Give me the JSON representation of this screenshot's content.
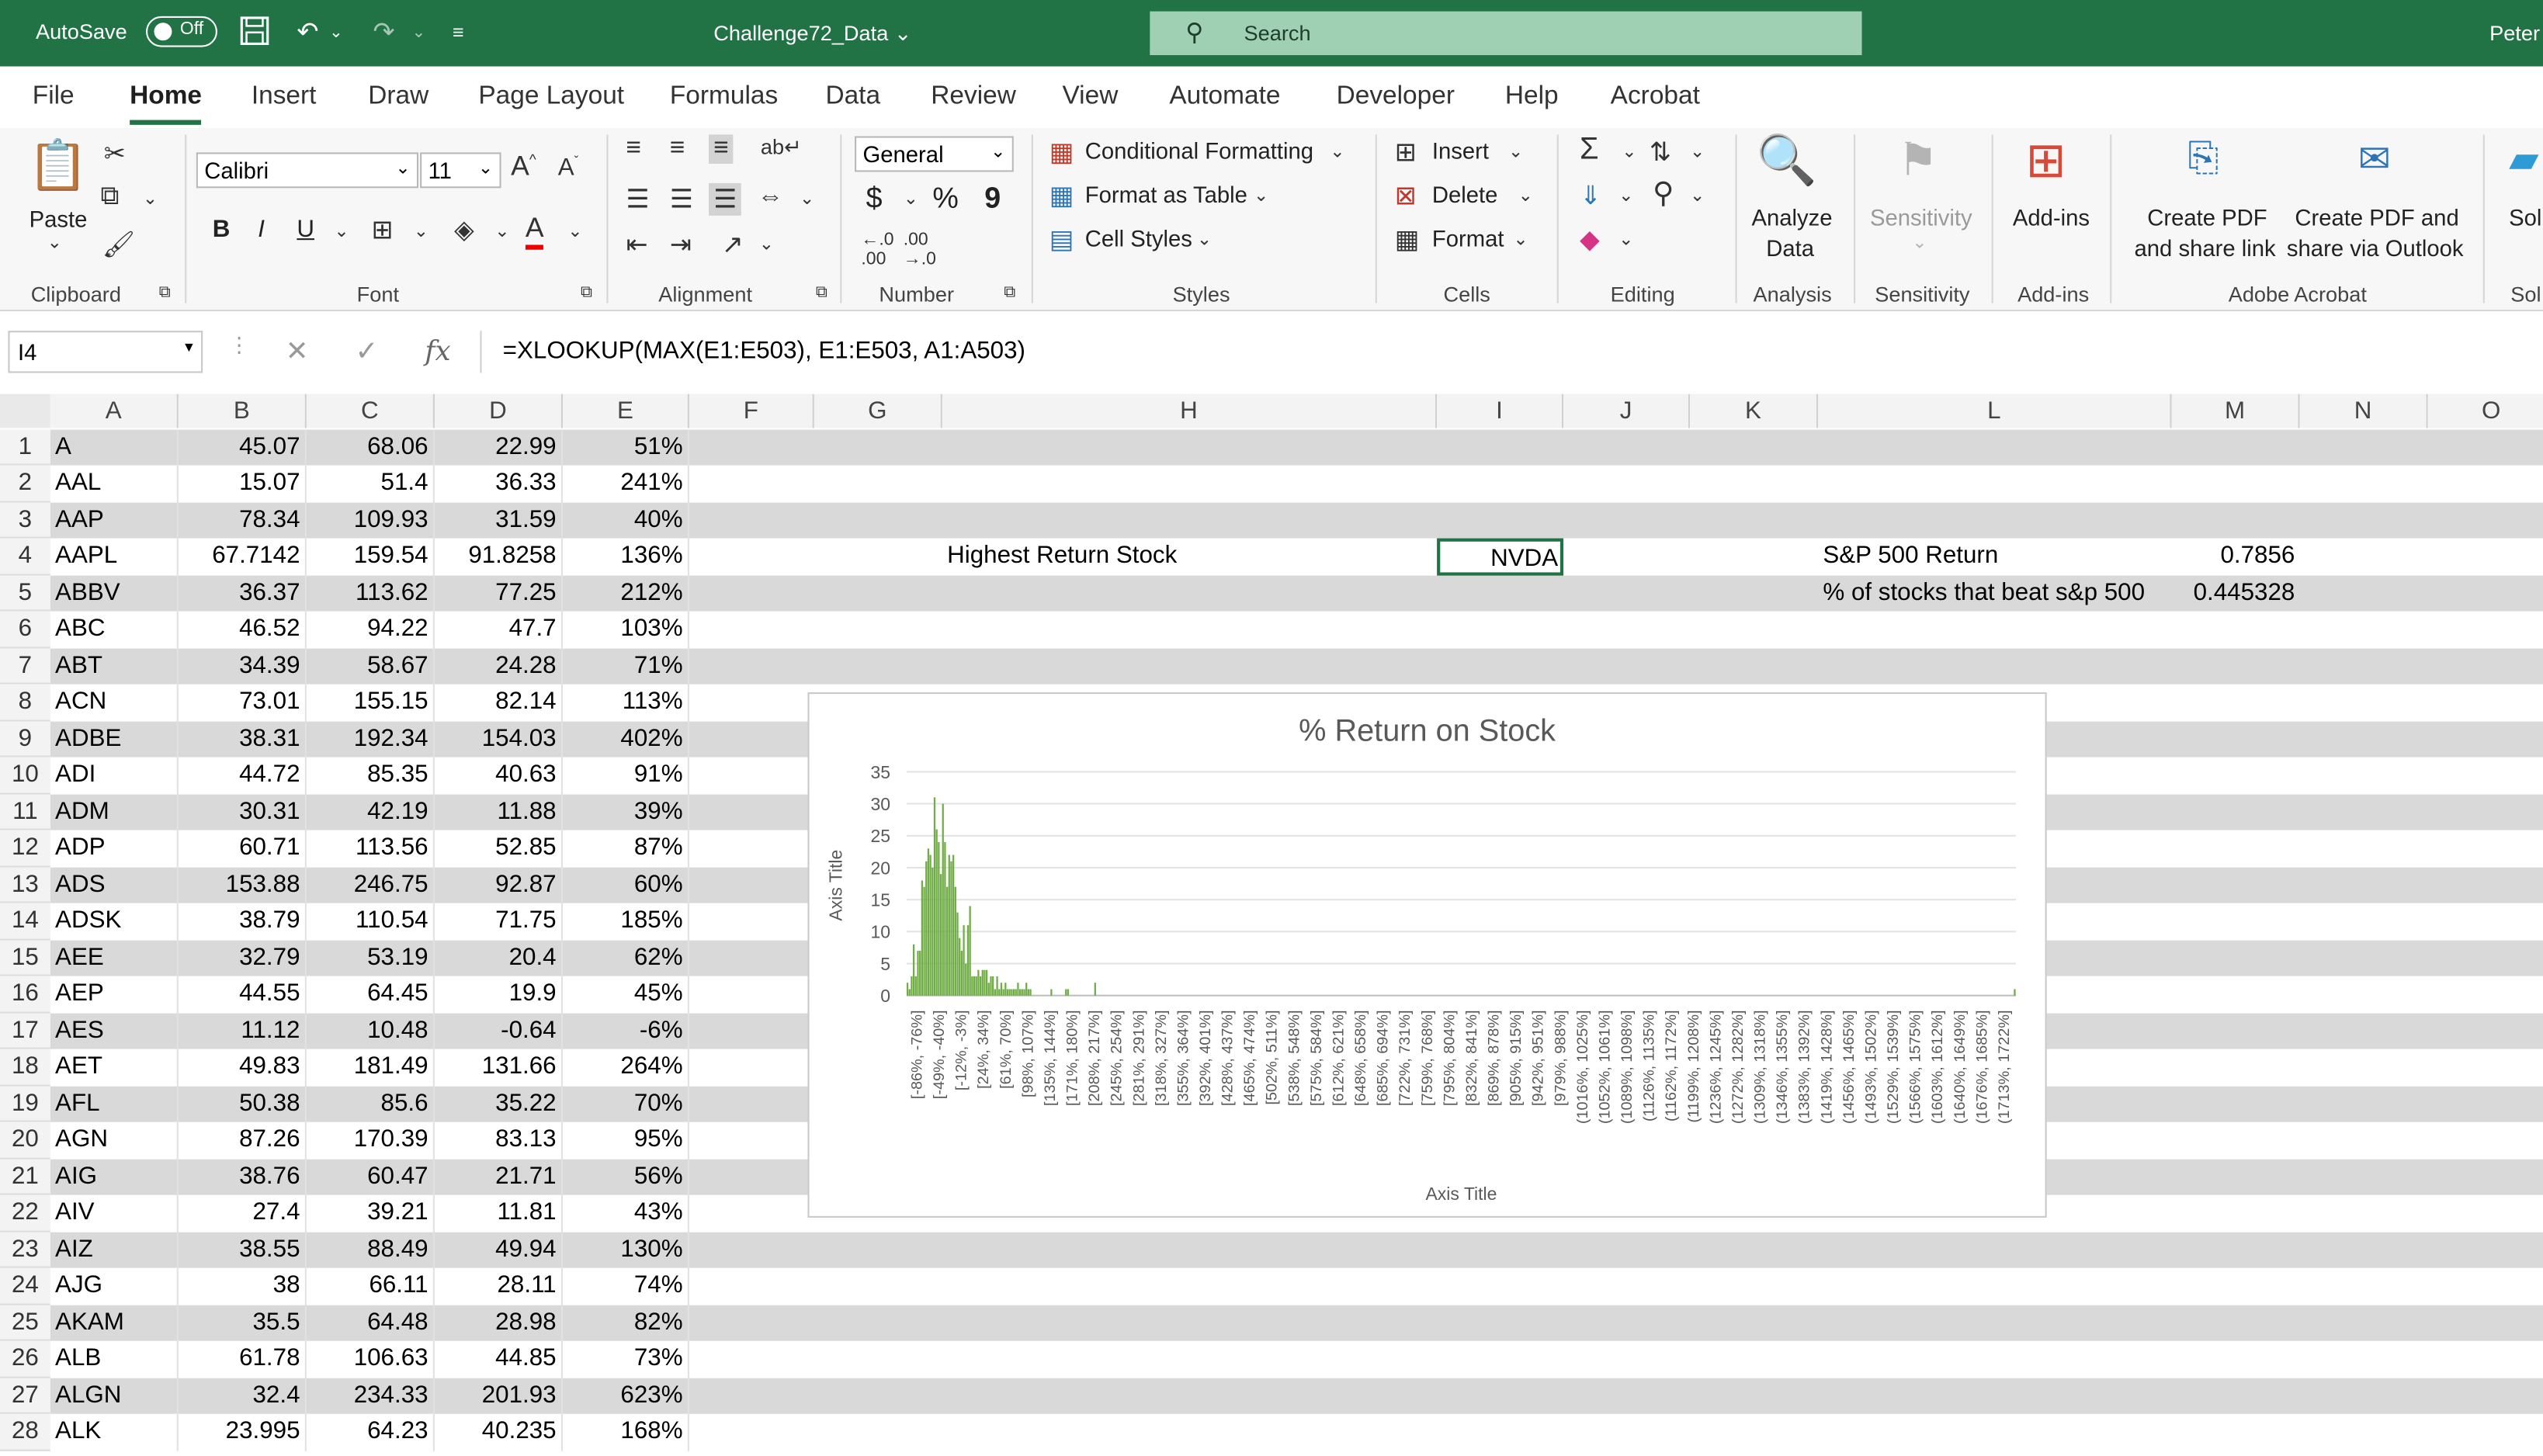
{
  "titlebar": {
    "autosave_label": "AutoSave",
    "autosave_state": "Off",
    "document_title": "Challenge72_Data",
    "search_placeholder": "Search",
    "user_name": "Peter"
  },
  "tabs": [
    "File",
    "Home",
    "Insert",
    "Draw",
    "Page Layout",
    "Formulas",
    "Data",
    "Review",
    "View",
    "Automate",
    "Developer",
    "Help",
    "Acrobat"
  ],
  "active_tab": "Home",
  "ribbon": {
    "clipboard": {
      "paste": "Paste",
      "group": "Clipboard"
    },
    "font": {
      "name": "Calibri",
      "size": "11",
      "group": "Font",
      "bold": "B",
      "italic": "I",
      "underline": "U"
    },
    "alignment": {
      "group": "Alignment"
    },
    "number": {
      "format": "General",
      "group": "Number",
      "currency": "$",
      "percent": "%",
      "comma": "9"
    },
    "styles": {
      "conditional": "Conditional Formatting",
      "format_table": "Format as Table",
      "cell_styles": "Cell Styles",
      "group": "Styles"
    },
    "cells": {
      "insert": "Insert",
      "delete": "Delete",
      "format": "Format",
      "group": "Cells"
    },
    "editing": {
      "group": "Editing"
    },
    "analysis": {
      "analyze_line1": "Analyze",
      "analyze_line2": "Data",
      "group": "Analysis"
    },
    "sensitivity": {
      "label": "Sensitivity",
      "group": "Sensitivity"
    },
    "addins": {
      "label": "Add-ins",
      "group": "Add-ins"
    },
    "acrobat": {
      "create_pdf_line1": "Create PDF",
      "create_pdf_line2": "and share link",
      "create_outlook_line1": "Create PDF and",
      "create_outlook_line2": "share via Outlook",
      "group": "Adobe Acrobat"
    },
    "extra_label": "Sol",
    "extra_group": "Sol"
  },
  "formula_bar": {
    "name_box": "I4",
    "fx": "fx",
    "formula": "=XLOOKUP(MAX(E1:E503), E1:E503, A1:A503)"
  },
  "columns": [
    "A",
    "B",
    "C",
    "D",
    "E",
    "F",
    "G",
    "H",
    "I",
    "J",
    "K",
    "L",
    "M",
    "N",
    "O"
  ],
  "rows": [
    {
      "n": "1",
      "a": "A",
      "b": "45.07",
      "c": "68.06",
      "d": "22.99",
      "e": "51%"
    },
    {
      "n": "2",
      "a": "AAL",
      "b": "15.07",
      "c": "51.4",
      "d": "36.33",
      "e": "241%"
    },
    {
      "n": "3",
      "a": "AAP",
      "b": "78.34",
      "c": "109.93",
      "d": "31.59",
      "e": "40%"
    },
    {
      "n": "4",
      "a": "AAPL",
      "b": "67.7142",
      "c": "159.54",
      "d": "91.8258",
      "e": "136%"
    },
    {
      "n": "5",
      "a": "ABBV",
      "b": "36.37",
      "c": "113.62",
      "d": "77.25",
      "e": "212%"
    },
    {
      "n": "6",
      "a": "ABC",
      "b": "46.52",
      "c": "94.22",
      "d": "47.7",
      "e": "103%"
    },
    {
      "n": "7",
      "a": "ABT",
      "b": "34.39",
      "c": "58.67",
      "d": "24.28",
      "e": "71%"
    },
    {
      "n": "8",
      "a": "ACN",
      "b": "73.01",
      "c": "155.15",
      "d": "82.14",
      "e": "113%"
    },
    {
      "n": "9",
      "a": "ADBE",
      "b": "38.31",
      "c": "192.34",
      "d": "154.03",
      "e": "402%"
    },
    {
      "n": "10",
      "a": "ADI",
      "b": "44.72",
      "c": "85.35",
      "d": "40.63",
      "e": "91%"
    },
    {
      "n": "11",
      "a": "ADM",
      "b": "30.31",
      "c": "42.19",
      "d": "11.88",
      "e": "39%"
    },
    {
      "n": "12",
      "a": "ADP",
      "b": "60.71",
      "c": "113.56",
      "d": "52.85",
      "e": "87%"
    },
    {
      "n": "13",
      "a": "ADS",
      "b": "153.88",
      "c": "246.75",
      "d": "92.87",
      "e": "60%"
    },
    {
      "n": "14",
      "a": "ADSK",
      "b": "38.79",
      "c": "110.54",
      "d": "71.75",
      "e": "185%"
    },
    {
      "n": "15",
      "a": "AEE",
      "b": "32.79",
      "c": "53.19",
      "d": "20.4",
      "e": "62%"
    },
    {
      "n": "16",
      "a": "AEP",
      "b": "44.55",
      "c": "64.45",
      "d": "19.9",
      "e": "45%"
    },
    {
      "n": "17",
      "a": "AES",
      "b": "11.12",
      "c": "10.48",
      "d": "-0.64",
      "e": "-6%"
    },
    {
      "n": "18",
      "a": "AET",
      "b": "49.83",
      "c": "181.49",
      "d": "131.66",
      "e": "264%"
    },
    {
      "n": "19",
      "a": "AFL",
      "b": "50.38",
      "c": "85.6",
      "d": "35.22",
      "e": "70%"
    },
    {
      "n": "20",
      "a": "AGN",
      "b": "87.26",
      "c": "170.39",
      "d": "83.13",
      "e": "95%"
    },
    {
      "n": "21",
      "a": "AIG",
      "b": "38.76",
      "c": "60.47",
      "d": "21.71",
      "e": "56%"
    },
    {
      "n": "22",
      "a": "AIV",
      "b": "27.4",
      "c": "39.21",
      "d": "11.81",
      "e": "43%"
    },
    {
      "n": "23",
      "a": "AIZ",
      "b": "38.55",
      "c": "88.49",
      "d": "49.94",
      "e": "130%"
    },
    {
      "n": "24",
      "a": "AJG",
      "b": "38",
      "c": "66.11",
      "d": "28.11",
      "e": "74%"
    },
    {
      "n": "25",
      "a": "AKAM",
      "b": "35.5",
      "c": "64.48",
      "d": "28.98",
      "e": "82%"
    },
    {
      "n": "26",
      "a": "ALB",
      "b": "61.78",
      "c": "106.63",
      "d": "44.85",
      "e": "73%"
    },
    {
      "n": "27",
      "a": "ALGN",
      "b": "32.4",
      "c": "234.33",
      "d": "201.93",
      "e": "623%"
    },
    {
      "n": "28",
      "a": "ALK",
      "b": "23.995",
      "c": "64.23",
      "d": "40.235",
      "e": "168%"
    }
  ],
  "extra_cells": {
    "h4": "Highest Return Stock",
    "i4": "NVDA",
    "l4": "S&P 500 Return",
    "m4": "0.7856",
    "l5": "% of stocks that beat s&p 500",
    "m5": "0.445328"
  },
  "colors": {
    "excel_green": "#217346",
    "bar_green": "#70ad47",
    "row_band": "#d9d9d9"
  },
  "chart_data": {
    "type": "bar",
    "title": "% Return on Stock",
    "xlabel": "Axis Title",
    "ylabel": "Axis Title",
    "ylim": [
      0,
      35
    ],
    "yticks": [
      "35",
      "30",
      "25",
      "20",
      "15",
      "10",
      "5",
      "0"
    ],
    "grid": true,
    "legend": "none",
    "categories": [
      "[-86%, -76%]",
      "[-49%, -40%]",
      "[-12%, -3%]",
      "[24%, 34%]",
      "[61%, 70%]",
      "[98%, 107%]",
      "[135%, 144%]",
      "[171%, 180%]",
      "[208%, 217%]",
      "[245%, 254%]",
      "[281%, 291%]",
      "[318%, 327%]",
      "[355%, 364%]",
      "[392%, 401%]",
      "[428%, 437%]",
      "[465%, 474%]",
      "[502%, 511%]",
      "[538%, 548%]",
      "[575%, 584%]",
      "[612%, 621%]",
      "[648%, 658%]",
      "[685%, 694%]",
      "[722%, 731%]",
      "[759%, 768%]",
      "[795%, 804%]",
      "[832%, 841%]",
      "[869%, 878%]",
      "[905%, 915%]",
      "[942%, 951%]",
      "[979%, 988%]",
      "(1016%, 1025%]",
      "(1052%, 1061%]",
      "(1089%, 1098%]",
      "(1126%, 1135%]",
      "(1162%, 1172%]",
      "(1199%, 1208%]",
      "(1236%, 1245%]",
      "(1272%, 1282%]",
      "(1309%, 1318%]",
      "(1346%, 1355%]",
      "(1383%, 1392%]",
      "(1419%, 1428%]",
      "(1456%, 1465%]",
      "(1493%, 1502%]",
      "(1529%, 1539%]",
      "(1566%, 1575%]",
      "(1603%, 1612%]",
      "(1640%, 1649%]",
      "(1676%, 1685%]",
      "(1713%, 1722%]"
    ],
    "values": [
      2,
      1,
      3,
      8,
      3,
      7,
      7,
      18,
      17,
      21,
      23,
      22,
      20,
      31,
      26,
      24,
      19,
      30,
      24,
      17,
      22,
      21,
      22,
      17,
      13,
      9,
      7,
      11,
      5,
      11,
      14,
      3,
      3,
      3,
      4,
      3,
      4,
      4,
      4,
      2,
      3,
      3,
      1,
      3,
      1,
      2,
      1,
      2,
      1,
      1,
      1,
      1,
      1,
      2,
      1,
      1,
      1,
      2,
      1,
      1,
      0,
      0,
      0,
      0,
      0,
      0,
      0,
      0,
      0,
      1,
      0,
      0,
      0,
      0,
      0,
      0,
      1,
      1,
      0,
      0,
      0,
      0,
      0,
      0,
      0,
      0,
      0,
      0,
      0,
      0,
      2,
      0,
      0,
      0,
      0,
      0,
      0,
      0,
      0,
      0,
      0,
      0,
      0,
      0,
      0,
      0,
      0,
      0,
      0,
      0,
      0,
      0,
      0,
      0,
      0,
      0,
      0,
      0,
      0,
      0,
      0,
      0,
      0,
      0,
      0,
      0,
      0,
      0,
      0,
      0,
      0,
      0,
      0,
      0,
      0,
      0,
      0,
      0,
      0,
      0,
      0,
      0,
      0,
      0,
      0,
      0,
      0,
      0,
      0,
      0,
      0,
      0,
      0,
      0,
      0,
      0,
      0,
      0,
      0,
      0,
      0,
      0,
      0,
      0,
      0,
      0,
      0,
      0,
      0,
      0,
      0,
      0,
      0,
      0,
      0,
      0,
      0,
      0,
      0,
      0,
      0,
      0,
      0,
      0,
      0,
      0,
      0,
      0,
      0,
      0,
      0,
      0,
      0,
      0,
      0,
      0,
      0,
      0,
      0,
      0,
      0,
      0,
      0,
      0,
      0,
      0,
      0,
      0,
      0,
      0,
      0,
      0,
      0,
      0,
      0,
      0,
      0,
      0,
      0,
      0,
      0,
      0,
      0,
      0,
      0,
      0,
      0,
      0,
      0,
      0,
      0,
      0,
      0,
      0,
      0,
      0,
      0,
      0,
      0,
      0,
      0,
      0,
      0,
      0,
      0,
      0,
      0,
      0,
      0,
      0,
      0,
      0,
      0,
      0,
      0,
      0,
      0,
      0,
      0,
      0,
      0,
      0,
      0,
      0,
      0,
      0,
      0,
      0,
      0,
      0,
      0,
      0,
      0,
      0,
      0,
      0,
      0,
      0,
      0,
      0,
      0,
      0,
      0,
      0,
      0,
      0,
      0,
      0,
      0,
      0,
      0,
      0,
      0,
      0,
      0,
      0,
      0,
      0,
      0,
      0,
      0,
      0,
      0,
      0,
      0,
      0,
      0,
      0,
      0,
      0,
      0,
      0,
      0,
      0,
      0,
      0,
      0,
      0,
      0,
      0,
      0,
      0,
      0,
      0,
      0,
      0,
      0,
      0,
      0,
      0,
      0,
      0,
      0,
      0,
      0,
      0,
      0,
      0,
      0,
      0,
      0,
      0,
      0,
      0,
      0,
      0,
      0,
      0,
      0,
      0,
      0,
      0,
      0,
      0,
      0,
      0,
      0,
      0,
      0,
      0,
      0,
      0,
      0,
      0,
      0,
      0,
      0,
      0,
      0,
      0,
      0,
      0,
      0,
      0,
      0,
      0,
      0,
      0,
      0,
      0,
      0,
      0,
      0,
      0,
      0,
      0,
      0,
      0,
      0,
      0,
      0,
      0,
      0,
      0,
      0,
      0,
      0,
      0,
      0,
      0,
      0,
      0,
      0,
      0,
      0,
      0,
      0,
      0,
      0,
      0,
      0,
      0,
      0,
      0,
      0,
      0,
      0,
      0,
      0,
      0,
      0,
      0,
      0,
      0,
      0,
      0,
      0,
      0,
      0,
      0,
      0,
      0,
      0,
      0,
      0,
      0,
      0,
      0,
      0,
      0,
      0,
      0,
      0,
      0,
      0,
      0,
      0,
      0,
      0,
      0,
      0,
      0,
      0,
      0,
      0,
      0,
      0,
      0,
      0,
      0,
      0,
      0,
      0,
      0,
      0,
      0,
      0,
      0,
      0,
      0,
      0,
      0,
      0,
      0,
      0,
      0,
      0,
      0,
      0,
      0,
      0,
      0,
      0,
      0,
      0,
      0,
      0,
      0,
      0,
      0,
      0,
      0,
      0,
      0,
      0,
      0,
      0,
      0,
      0,
      0,
      0,
      0,
      0,
      0,
      0,
      0,
      0,
      0,
      0,
      0,
      0,
      0,
      0,
      0,
      0,
      0,
      0,
      0,
      0,
      0,
      0,
      0,
      0,
      0,
      0,
      0,
      0,
      0,
      0,
      0,
      0,
      1
    ]
  }
}
